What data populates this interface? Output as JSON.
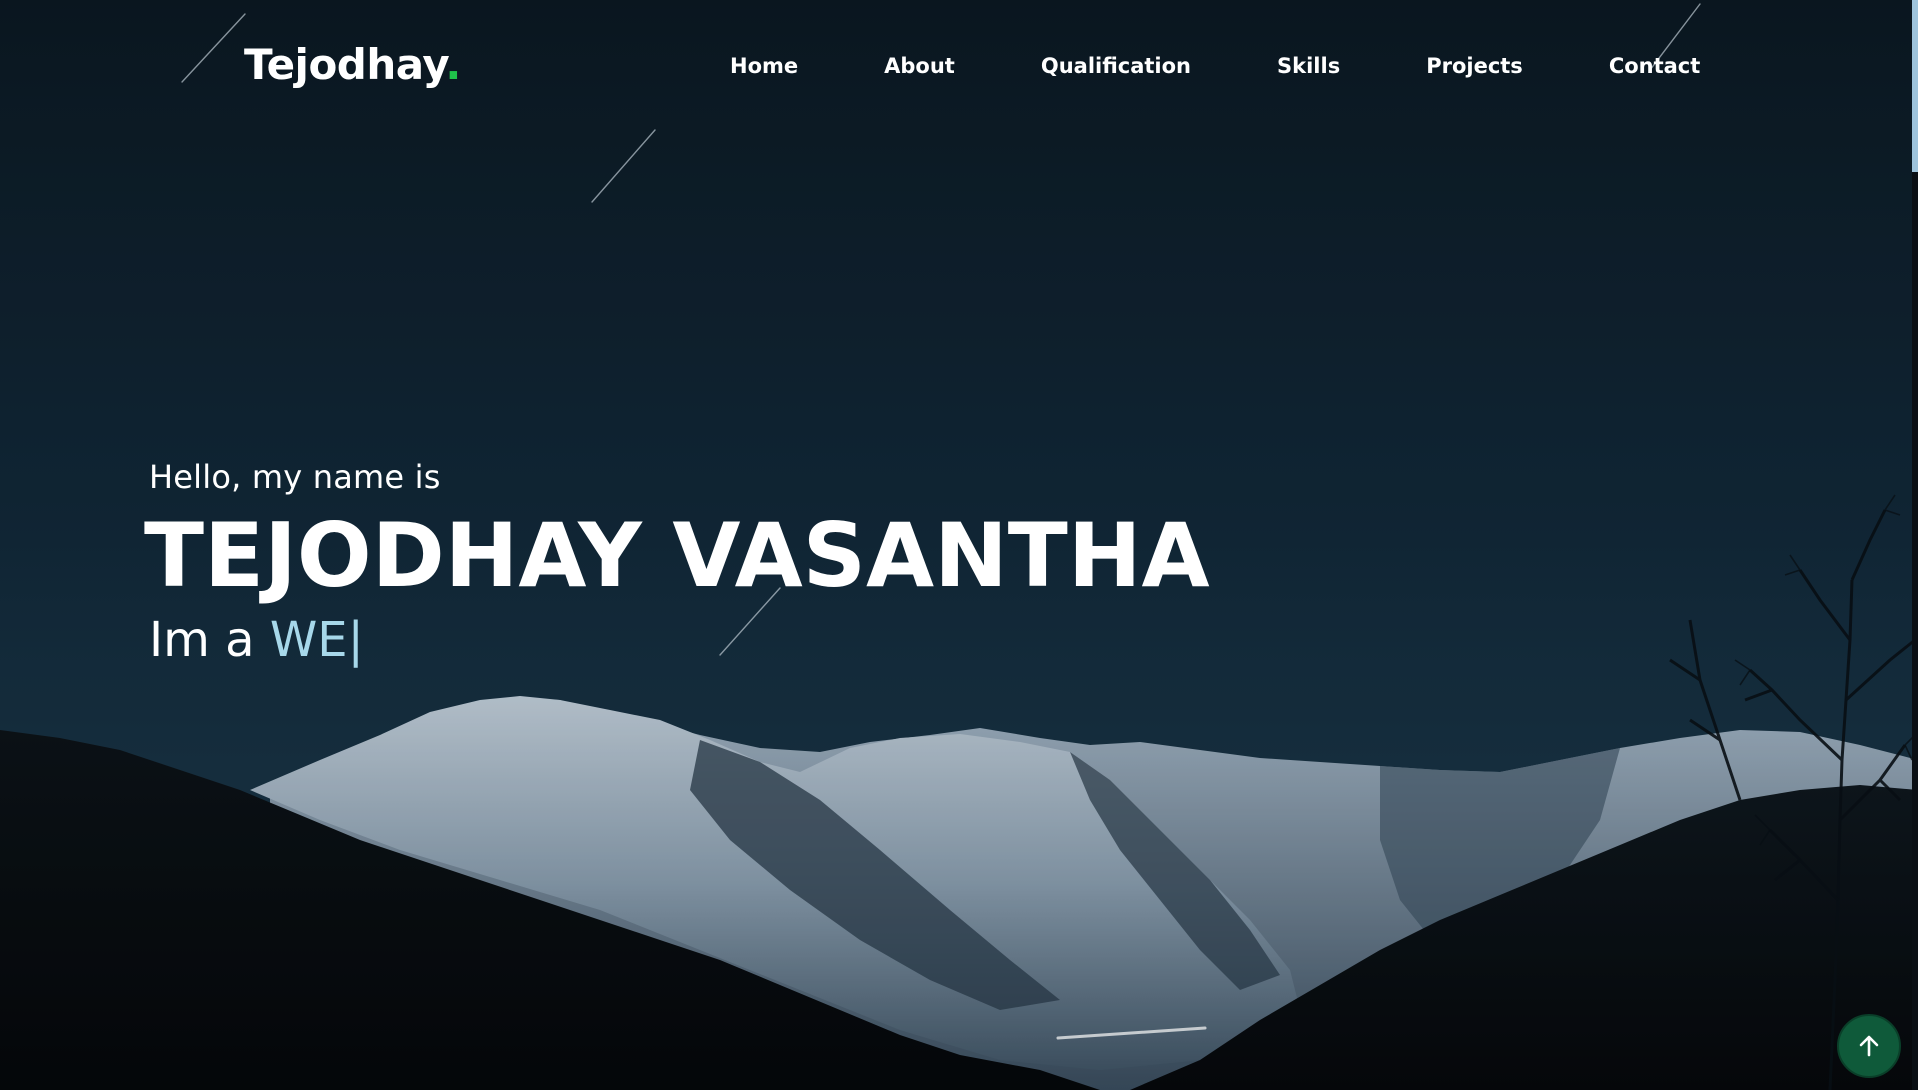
{
  "nav": {
    "logo_text": "Tejodhay",
    "logo_dot": ".",
    "items": [
      {
        "label": "Home"
      },
      {
        "label": "About"
      },
      {
        "label": "Qualification"
      },
      {
        "label": "Skills"
      },
      {
        "label": "Projects"
      },
      {
        "label": "Contact"
      }
    ]
  },
  "hero": {
    "greeting": "Hello, my name is",
    "name": "TEJODHAY VASANTHA",
    "role_prefix": "Im a ",
    "role_typed": "WE",
    "cursor": "|"
  },
  "colors": {
    "accent_dot": "#1fc24a",
    "typed_text": "#a7d8ea",
    "back_to_top_bg": "#0f5a3a"
  },
  "icons": {
    "back_to_top": "arrow-up-icon"
  }
}
